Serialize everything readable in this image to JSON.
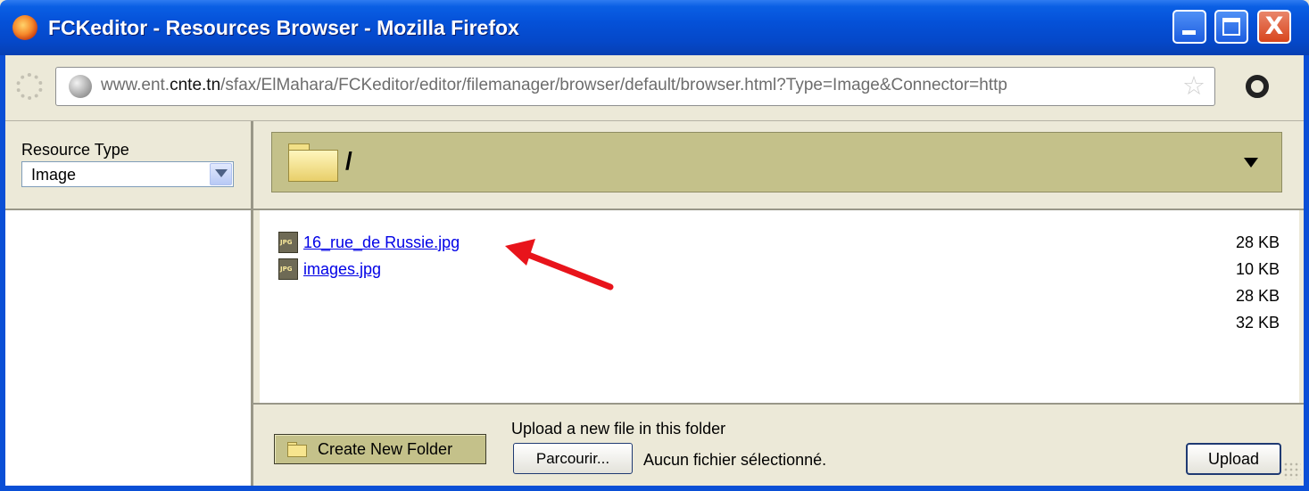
{
  "window": {
    "title": "FCKeditor - Resources Browser - Mozilla Firefox",
    "close_glyph": "X"
  },
  "address_bar": {
    "url_prefix": "www.ent.",
    "url_domain": "cnte.tn",
    "url_rest": "/sfax/ElMahara/FCKeditor/editor/filemanager/browser/default/browser.html?Type=Image&Connector=http"
  },
  "sidebar": {
    "resource_type_label": "Resource Type",
    "resource_type_value": "Image"
  },
  "pathbar": {
    "current_path": "/"
  },
  "files": [
    {
      "icon_label": "JPG",
      "name": "16_rue_de Russie.jpg"
    },
    {
      "icon_label": "JPG",
      "name": "images.jpg"
    }
  ],
  "sizes": [
    "28 KB",
    "10 KB",
    "28 KB",
    "32 KB"
  ],
  "bottom": {
    "create_folder_label": "Create New Folder",
    "upload_label": "Upload a new file in this folder",
    "browse_label": "Parcourir...",
    "no_file_label": "Aucun fichier sélectionné.",
    "upload_button": "Upload"
  },
  "colors": {
    "titlebar": "#0551d8",
    "panel": "#c4c18a",
    "link": "#0000e6",
    "annotation": "#e8141b"
  }
}
